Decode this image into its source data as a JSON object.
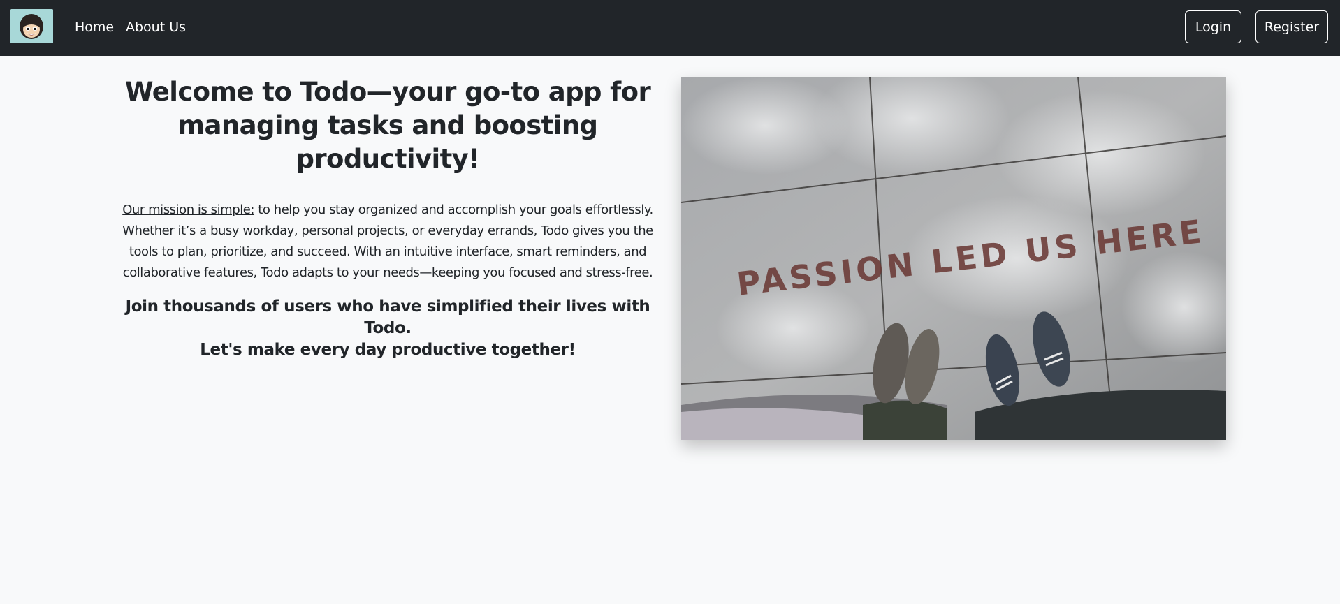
{
  "navbar": {
    "logo_icon": "one-piece-luffy-avatar-icon",
    "links": [
      "Home",
      "About Us"
    ],
    "login_label": "Login",
    "register_label": "Register",
    "background": "#212529"
  },
  "main": {
    "headline": "Welcome to Todo—your go-to app for managing tasks and boosting productivity!",
    "mission_lead": "Our mission is simple:",
    "mission_text": " to help you stay organized and accomplish your goals effortlessly. Whether it’s a busy workday, personal projects, or everyday errands, Todo gives you the tools to plan, prioritize, and succeed. With an intuitive interface, smart reminders, and collaborative features, Todo adapts to your needs—keeping you focused and stress-free.",
    "join_line1": "Join thousands of users who have simplified their lives with Todo.",
    "join_line2": "Let's make every day productive together!"
  },
  "hero_image": {
    "caption": "PASSION LED US HERE"
  }
}
